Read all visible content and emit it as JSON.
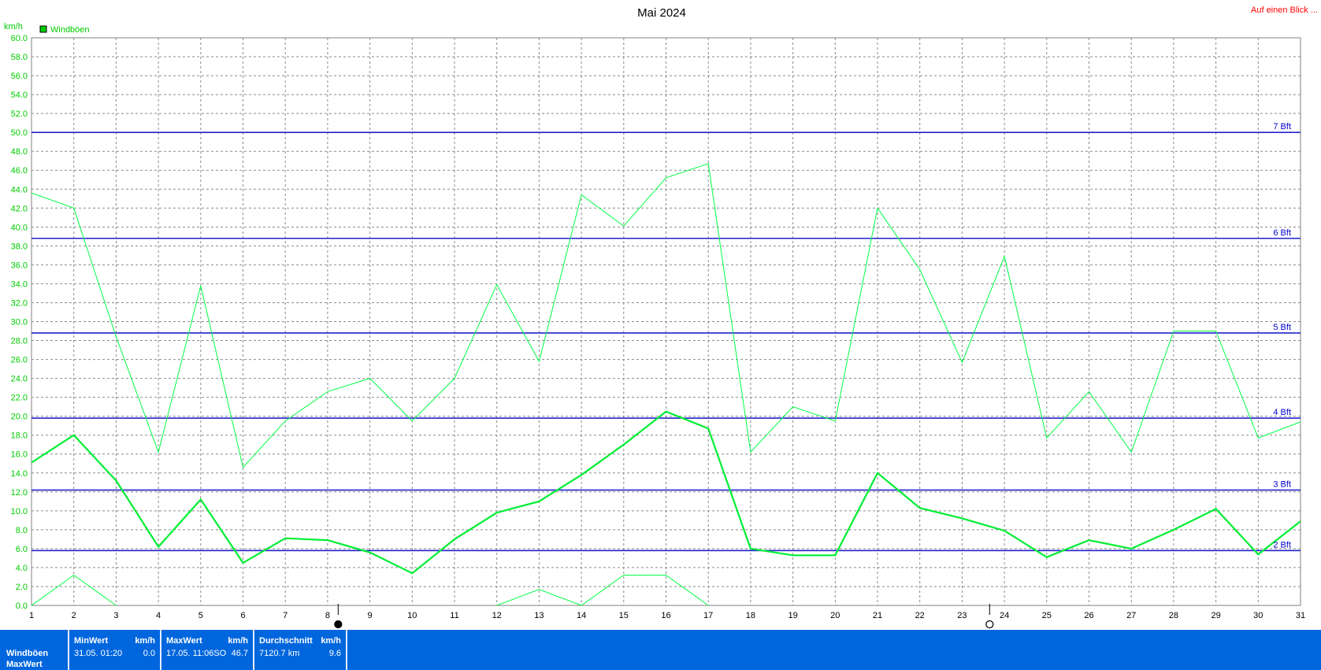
{
  "title": "Mai 2024",
  "link": "Auf einen Blick ...",
  "unit": "km/h",
  "legend": {
    "label": "Windböen",
    "color": "#00cc00"
  },
  "chart_data": {
    "type": "line",
    "title": "Mai 2024",
    "ylabel": "km/h",
    "xlabel": "",
    "ylim": [
      0,
      60
    ],
    "yticks": [
      "0.0",
      "2.0",
      "4.0",
      "6.0",
      "8.0",
      "10.0",
      "12.0",
      "14.0",
      "16.0",
      "18.0",
      "20.0",
      "22.0",
      "24.0",
      "26.0",
      "28.0",
      "30.0",
      "32.0",
      "34.0",
      "36.0",
      "38.0",
      "40.0",
      "42.0",
      "44.0",
      "46.0",
      "48.0",
      "50.0",
      "52.0",
      "54.0",
      "56.0",
      "58.0",
      "60.0"
    ],
    "x": [
      1,
      2,
      3,
      4,
      5,
      6,
      7,
      8,
      9,
      10,
      11,
      12,
      13,
      14,
      15,
      16,
      17,
      18,
      19,
      20,
      21,
      22,
      23,
      24,
      25,
      26,
      27,
      28,
      29,
      30,
      31
    ],
    "grid": true,
    "legend_position": "top-left",
    "series": [
      {
        "name": "Windböen",
        "role": "max",
        "color": "#00ff44",
        "width": 1,
        "values": [
          43.6,
          42.0,
          28.4,
          16.2,
          33.8,
          14.6,
          19.5,
          22.6,
          24.0,
          19.5,
          24.0,
          33.9,
          25.8,
          43.4,
          40.1,
          45.2,
          46.7,
          16.2,
          21.0,
          19.5,
          42.0,
          35.5,
          25.7,
          36.9,
          17.7,
          22.6,
          16.2,
          29.0,
          29.0,
          17.7,
          19.4
        ]
      },
      {
        "name": "",
        "role": "avg",
        "color": "#00ee33",
        "width": 2.2,
        "values": [
          15.1,
          18.0,
          13.2,
          6.2,
          11.2,
          4.5,
          7.1,
          6.9,
          5.6,
          3.4,
          7.0,
          9.8,
          11.0,
          13.8,
          17.0,
          20.5,
          18.7,
          6.0,
          5.3,
          5.3,
          14.0,
          10.3,
          9.2,
          7.9,
          5.1,
          6.9,
          6.0,
          8.0,
          10.2,
          5.4,
          8.9
        ]
      },
      {
        "name": "",
        "role": "min",
        "color": "#00ff44",
        "width": 1,
        "values": [
          0.0,
          3.2,
          0.0,
          null,
          null,
          null,
          null,
          null,
          null,
          null,
          null,
          0.0,
          1.7,
          0.0,
          3.2,
          3.2,
          0.0,
          null,
          null,
          null,
          null,
          null,
          null,
          null,
          null,
          null,
          null,
          null,
          null,
          null,
          null
        ]
      }
    ],
    "reference_lines": [
      {
        "label": "2 Bft",
        "value": 5.8
      },
      {
        "label": "3 Bft",
        "value": 12.2
      },
      {
        "label": "4 Bft",
        "value": 19.8
      },
      {
        "label": "5 Bft",
        "value": 28.8
      },
      {
        "label": "6 Bft",
        "value": 38.8
      },
      {
        "label": "7 Bft",
        "value": 50.0
      }
    ],
    "moon_phases": [
      {
        "icon": "moon-full-icon",
        "day": 8.25
      },
      {
        "icon": "moon-new-icon",
        "day": 23.65
      }
    ]
  },
  "footer": {
    "row_labels": [
      "Windböen",
      "MaxWert"
    ],
    "stats": [
      {
        "header": "MinWert",
        "unit": "km/h",
        "time": "31.05.  01:20",
        "value": "0.0"
      },
      {
        "header": "MaxWert",
        "unit": "km/h",
        "time": "17.05.  11:06SO",
        "value": "46.7"
      },
      {
        "header": "Durchschnitt",
        "unit": "km/h",
        "time": "7120.7 km",
        "value": "9.6"
      }
    ]
  }
}
